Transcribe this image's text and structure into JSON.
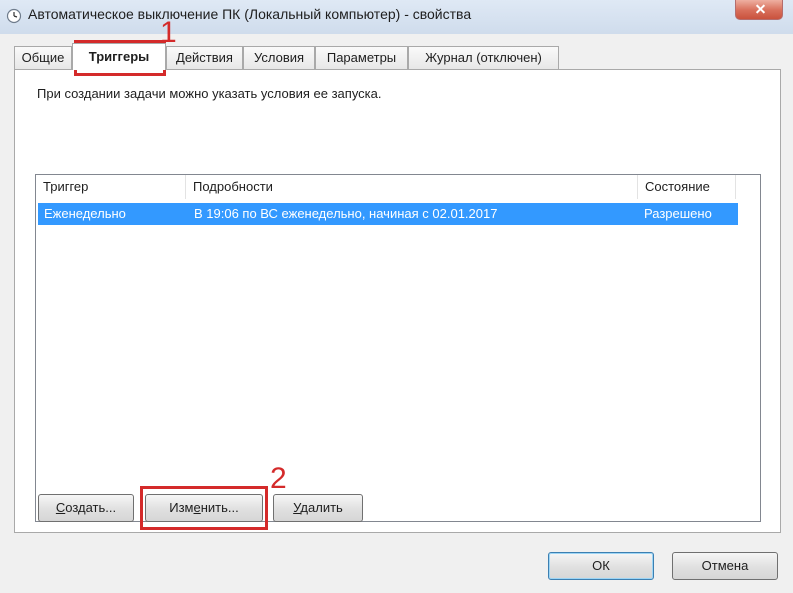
{
  "window": {
    "title": "Автоматическое выключение ПК (Локальный компьютер) - свойства"
  },
  "tabs": [
    {
      "label": "Общие"
    },
    {
      "label": "Триггеры"
    },
    {
      "label": "Действия"
    },
    {
      "label": "Условия"
    },
    {
      "label": "Параметры"
    },
    {
      "label": "Журнал (отключен)"
    }
  ],
  "active_tab": "Триггеры",
  "panel": {
    "intro": "При создании задачи можно указать условия ее запуска."
  },
  "trigger_table": {
    "columns": [
      "Триггер",
      "Подробности",
      "Состояние"
    ],
    "rows": [
      {
        "trigger": "Еженедельно",
        "details": "В 19:06 по ВС еженедельно, начиная с 02.01.2017",
        "state": "Разрешено"
      }
    ]
  },
  "buttons": {
    "create_acc": "С",
    "create_rest": "оздать...",
    "edit_pre": "Изм",
    "edit_acc": "е",
    "edit_post": "нить...",
    "delete_acc": "У",
    "delete_rest": "далить",
    "ok": "ОК",
    "cancel": "Отмена"
  },
  "annotations": {
    "marker_1": "1",
    "marker_2": "2"
  },
  "colors": {
    "selection": "#3399ff",
    "annotation": "#d42a2a"
  }
}
